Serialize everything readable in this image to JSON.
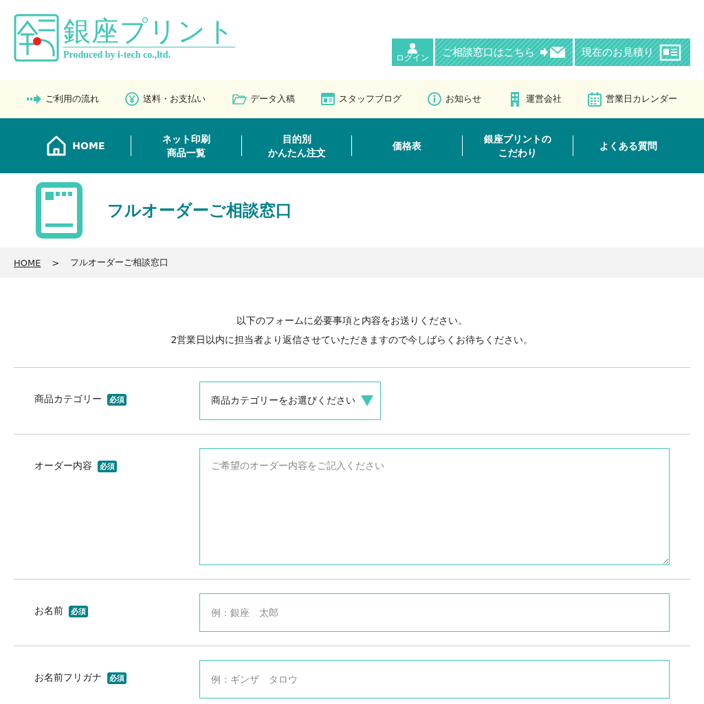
{
  "logo": {
    "name": "銀座プリント",
    "tagline": "Produced by i-tech co.,ltd."
  },
  "header_buttons": [
    {
      "kind": "login",
      "label": "ログイン"
    },
    {
      "kind": "mail",
      "label": "ご相談窓口はこちら"
    },
    {
      "kind": "estimate",
      "label": "現在のお見積り"
    }
  ],
  "sub_nav": [
    {
      "kind": "arrow",
      "label": "ご利用の流れ"
    },
    {
      "kind": "yen",
      "label": "送料・お支払い"
    },
    {
      "kind": "folder",
      "label": "データ入稿"
    },
    {
      "kind": "blog",
      "label": "スタッフブログ"
    },
    {
      "kind": "info",
      "label": "お知らせ"
    },
    {
      "kind": "building",
      "label": "運営会社"
    },
    {
      "kind": "calendar",
      "label": "営業日カレンダー"
    }
  ],
  "main_nav": [
    {
      "kind": "home",
      "lines": [
        "HOME"
      ]
    },
    {
      "kind": "text",
      "lines": [
        "ネット印刷",
        "商品一覧"
      ]
    },
    {
      "kind": "text",
      "lines": [
        "目的別",
        "かんたん注文"
      ]
    },
    {
      "kind": "text",
      "lines": [
        "価格表"
      ]
    },
    {
      "kind": "text",
      "lines": [
        "銀座プリントの",
        "こだわり"
      ]
    },
    {
      "kind": "text",
      "lines": [
        "よくある質問"
      ]
    }
  ],
  "page_title": "フルオーダーご相談窓口",
  "breadcrumb": [
    {
      "label": "HOME",
      "link": true
    },
    {
      "label": "フルオーダーご相談窓口",
      "link": false
    }
  ],
  "breadcrumb_separator": ">",
  "intro": [
    "以下のフォームに必要事項と内容をお送りください。",
    "2営業日以内に担当者より返信させていただきますので今しばらくお待ちください。"
  ],
  "form": [
    {
      "label": "商品カテゴリー",
      "badge": "必須",
      "kind": "select",
      "value": "商品カテゴリーをお選びください"
    },
    {
      "label": "オーダー内容",
      "badge": "必須",
      "kind": "textarea",
      "placeholder": "ご希望のオーダー内容をご記入ください"
    },
    {
      "label": "お名前",
      "badge": "必須",
      "kind": "input",
      "placeholder": "例：銀座　太郎"
    },
    {
      "label": "お名前フリガナ",
      "badge": "必須",
      "kind": "input",
      "placeholder": "例：ギンザ　タロウ"
    }
  ]
}
